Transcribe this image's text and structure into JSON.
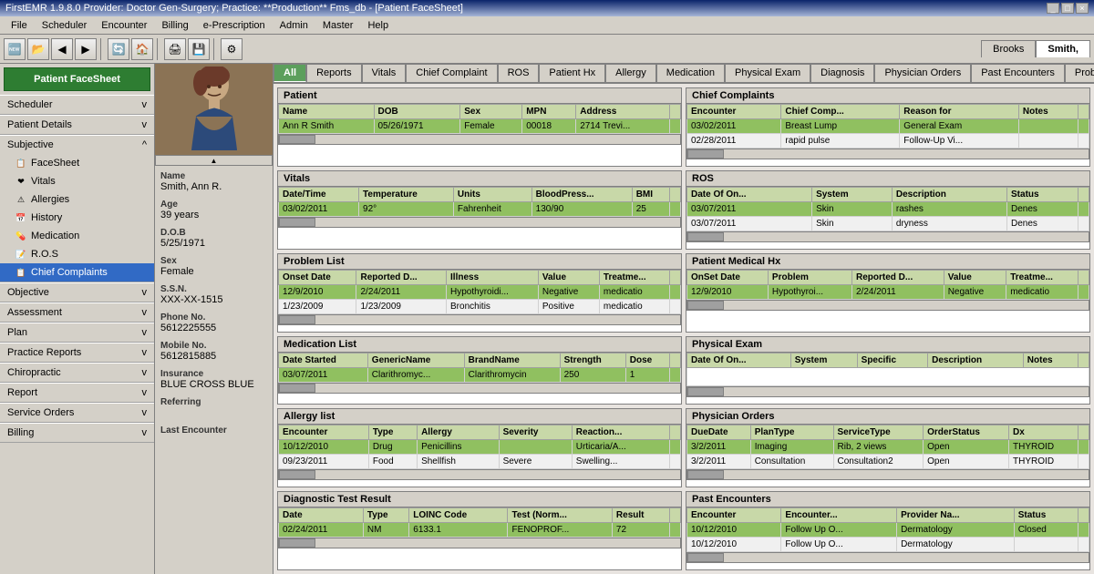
{
  "titleBar": {
    "text": "FirstEMR 1.9.8.0 Provider: Doctor Gen-Surgery; Practice: **Production** Fms_db - [Patient FaceSheet]",
    "minBtn": "_",
    "maxBtn": "□",
    "closeBtn": "×"
  },
  "menuBar": {
    "items": [
      "File",
      "Scheduler",
      "Encounter",
      "Billing",
      "e-Prescription",
      "Admin",
      "Master",
      "Help"
    ]
  },
  "userTabs": {
    "tab1": "Brooks",
    "tab2": "Smith,"
  },
  "sidebar": {
    "facesheetBtn": "Patient FaceSheet",
    "sections": [
      {
        "label": "Scheduler",
        "arrow": "v",
        "expanded": false,
        "items": []
      },
      {
        "label": "Patient Details",
        "arrow": "v",
        "expanded": false,
        "items": []
      },
      {
        "label": "Subjective",
        "arrow": "^",
        "expanded": true,
        "items": [
          {
            "label": "FaceSheet",
            "icon": "📋"
          },
          {
            "label": "Vitals",
            "icon": "❤"
          },
          {
            "label": "Allergies",
            "icon": "⚠"
          },
          {
            "label": "History",
            "icon": "📅"
          },
          {
            "label": "Medication",
            "icon": "💊"
          },
          {
            "label": "R.O.S",
            "icon": "📝"
          },
          {
            "label": "Chief Complaints",
            "icon": "📋"
          }
        ]
      },
      {
        "label": "Objective",
        "arrow": "v",
        "expanded": false,
        "items": []
      },
      {
        "label": "Assessment",
        "arrow": "v",
        "expanded": false,
        "items": []
      },
      {
        "label": "Plan",
        "arrow": "v",
        "expanded": false,
        "items": []
      },
      {
        "label": "Practice Reports",
        "arrow": "v",
        "expanded": false,
        "items": []
      },
      {
        "label": "Chiropractic",
        "arrow": "v",
        "expanded": false,
        "items": []
      },
      {
        "label": "Report",
        "arrow": "v",
        "expanded": false,
        "items": []
      },
      {
        "label": "Service Orders",
        "arrow": "v",
        "expanded": false,
        "items": []
      },
      {
        "label": "Billing",
        "arrow": "v",
        "expanded": false,
        "items": []
      }
    ]
  },
  "patientInfo": {
    "name": "Smith, Ann R.",
    "ageLabel": "Age",
    "age": "39 years",
    "dobLabel": "D.O.B",
    "dob": "5/25/1971",
    "sexLabel": "Sex",
    "sex": "Female",
    "ssnLabel": "S.S.N.",
    "ssn": "XXX-XX-1515",
    "phoneLabel": "Phone No.",
    "phone": "5612225555",
    "mobileLabel": "Mobile No.",
    "mobile": "5612815885",
    "insuranceLabel": "Insurance",
    "insurance": "BLUE CROSS BLUE",
    "referringLabel": "Referring",
    "referring": "",
    "lastEncounterLabel": "Last Encounter"
  },
  "tabs": {
    "items": [
      "All",
      "Reports",
      "Vitals",
      "Chief Complaint",
      "ROS",
      "Patient Hx",
      "Allergy",
      "Medication",
      "Physical Exam",
      "Diagnosis",
      "Physician Orders",
      "Past Encounters",
      "Problem List"
    ]
  },
  "sections": {
    "patient": {
      "title": "Patient",
      "columns": [
        "Name",
        "DOB",
        "Sex",
        "MPN",
        "Address"
      ],
      "rows": [
        [
          "Ann R Smith",
          "05/26/1971",
          "Female",
          "00018",
          "2714 Trevi..."
        ]
      ]
    },
    "chiefComplaints": {
      "title": "Chief Complaints",
      "columns": [
        "Encounter",
        "Chief Comp...",
        "Reason for",
        "Notes"
      ],
      "rows": [
        [
          "03/02/2011",
          "Breast Lump",
          "General Exam",
          ""
        ],
        [
          "02/28/2011",
          "rapid pulse",
          "Follow-Up Vi...",
          ""
        ]
      ]
    },
    "vitals": {
      "title": "Vitals",
      "columns": [
        "Date/Time",
        "Temperature",
        "Units",
        "BloodPress...",
        "BMI"
      ],
      "rows": [
        [
          "03/02/2011",
          "92°",
          "Fahrenheit",
          "130/90",
          "25"
        ]
      ]
    },
    "ros": {
      "title": "ROS",
      "columns": [
        "Date Of On...",
        "System",
        "Description",
        "Status"
      ],
      "rows": [
        [
          "03/07/2011",
          "Skin",
          "rashes",
          "Denes"
        ],
        [
          "03/07/2011",
          "Skin",
          "dryness",
          "Denes"
        ]
      ]
    },
    "problemList": {
      "title": "Problem List",
      "columns": [
        "Onset Date",
        "Reported D...",
        "Illness",
        "Value",
        "Treatme..."
      ],
      "rows": [
        [
          "12/9/2010",
          "2/24/2011",
          "Hypothyroidi...",
          "Negative",
          "medicatio"
        ],
        [
          "1/23/2009",
          "1/23/2009",
          "Bronchitis",
          "Positive",
          "medicatio"
        ]
      ]
    },
    "patientMedicalHx": {
      "title": "Patient Medical Hx",
      "columns": [
        "OnSet Date",
        "Problem",
        "Reported D...",
        "Value",
        "Treatme..."
      ],
      "rows": [
        [
          "12/9/2010",
          "Hypothyroi...",
          "2/24/2011",
          "Negative",
          "medicatio"
        ]
      ]
    },
    "medicationList": {
      "title": "Medication List",
      "columns": [
        "Date Started",
        "GenericName",
        "BrandName",
        "Strength",
        "Dose"
      ],
      "rows": [
        [
          "03/07/2011",
          "Clarithromyc...",
          "Clarithromycin",
          "250",
          "1"
        ]
      ]
    },
    "physicalExam": {
      "title": "Physical Exam",
      "columns": [
        "Date Of On...",
        "System",
        "Specific",
        "Description",
        "Notes"
      ],
      "rows": []
    },
    "allergyList": {
      "title": "Allergy list",
      "columns": [
        "Encounter",
        "Type",
        "Allergy",
        "Severity",
        "Reaction..."
      ],
      "rows": [
        [
          "10/12/2010",
          "Drug",
          "Penicillins",
          "",
          "Urticaria/A..."
        ],
        [
          "09/23/2011",
          "Food",
          "Shellfish",
          "Severe",
          "Swelling..."
        ]
      ]
    },
    "physicianOrders": {
      "title": "Physician Orders",
      "columns": [
        "DueDate",
        "PlanType",
        "ServiceType",
        "OrderStatus",
        "Dx"
      ],
      "rows": [
        [
          "3/2/2011",
          "Imaging",
          "Rib, 2 views",
          "Open",
          "THYROID"
        ],
        [
          "3/2/2011",
          "Consultation",
          "Consultation2",
          "Open",
          "THYROID"
        ]
      ]
    },
    "diagnosticTestResult": {
      "title": "Diagnostic Test Result",
      "columns": [
        "Date",
        "Type",
        "LOINC Code",
        "Test (Norm...",
        "Result"
      ],
      "rows": [
        [
          "02/24/2011",
          "NM",
          "6133.1",
          "FENOPROF...",
          "72"
        ]
      ]
    },
    "pastEncounters": {
      "title": "Past Encounters",
      "columns": [
        "Encounter",
        "Encounter...",
        "Provider Na...",
        "Status"
      ],
      "rows": [
        [
          "10/12/2010",
          "Follow Up O...",
          "Dermatology",
          "Closed"
        ],
        [
          "10/12/2010",
          "Follow Up O...",
          "Dermatology",
          ""
        ]
      ]
    }
  },
  "colors": {
    "headerBg": "#c8d8a8",
    "selectedRow": "#90c060",
    "sectionTitle": "#d4d0c8",
    "activeGreen": "#2e7d32",
    "tabAll": "#5c9f5c"
  }
}
